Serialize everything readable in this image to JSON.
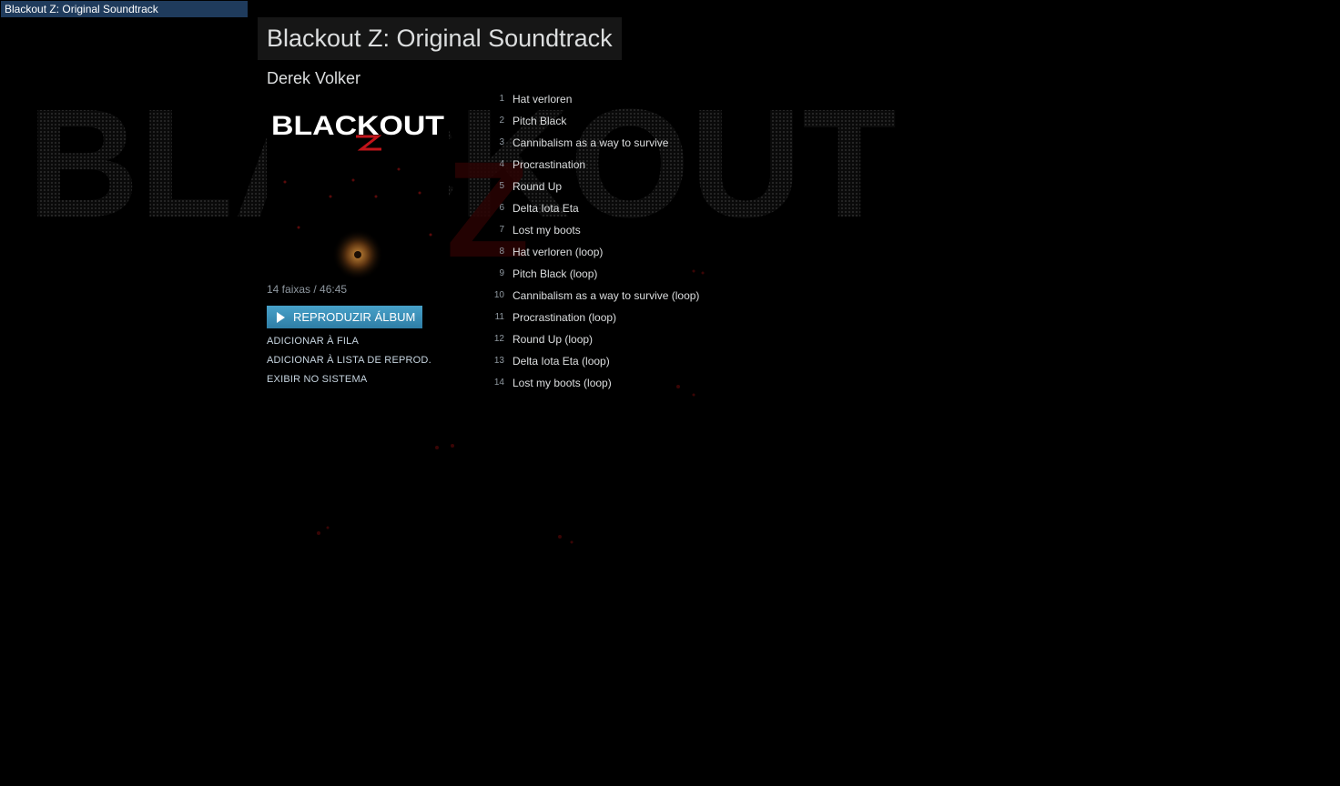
{
  "window": {
    "title": "Blackout Z: Original Soundtrack"
  },
  "sidebar": {
    "items": [
      {
        "label": "Blackout Z: Original Soundtrack",
        "selected": true
      }
    ]
  },
  "album": {
    "title": "Blackout Z: Original Soundtrack",
    "artist": "Derek Volker",
    "cover_logo": "BLACKOUT",
    "summary": "14 faixas / 46:45"
  },
  "background_art": {
    "text": "BLACKOUT",
    "accent_letter": "Z"
  },
  "actions": {
    "play_label": "REPRODUZIR ÁLBUM",
    "queue_label": "ADICIONAR À FILA",
    "playlist_label": "ADICIONAR À LISTA DE REPROD.",
    "system_label": "EXIBIR NO SISTEMA"
  },
  "tracks": [
    {
      "num": "1",
      "name": "Hat verloren"
    },
    {
      "num": "2",
      "name": "Pitch Black"
    },
    {
      "num": "3",
      "name": "Cannibalism as a way to survive"
    },
    {
      "num": "4",
      "name": "Procrastination"
    },
    {
      "num": "5",
      "name": "Round Up"
    },
    {
      "num": "6",
      "name": "Delta Iota Eta"
    },
    {
      "num": "7",
      "name": "Lost my boots"
    },
    {
      "num": "8",
      "name": "Hat verloren (loop)"
    },
    {
      "num": "9",
      "name": "Pitch Black (loop)"
    },
    {
      "num": "10",
      "name": "Cannibalism as a way to survive (loop)"
    },
    {
      "num": "11",
      "name": "Procrastination (loop)"
    },
    {
      "num": "12",
      "name": "Round Up (loop)"
    },
    {
      "num": "13",
      "name": "Delta Iota Eta (loop)"
    },
    {
      "num": "14",
      "name": "Lost my boots (loop)"
    }
  ],
  "colors": {
    "accent_blue": "#47a1c9",
    "sidebar_selected": "#1f3b5c",
    "background": "#000000",
    "logo_red": "#c0141a"
  }
}
